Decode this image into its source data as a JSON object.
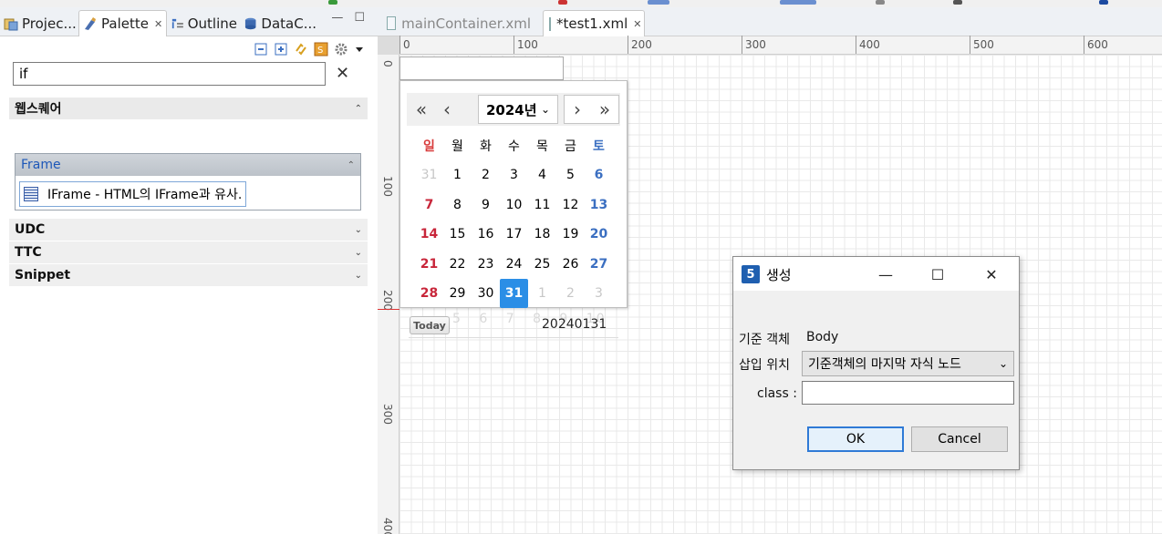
{
  "view_tabs": [
    {
      "label": "Projec...",
      "icon": "project-icon"
    },
    {
      "label": "Palette",
      "icon": "palette-icon",
      "active": true
    },
    {
      "label": "Outline",
      "icon": "outline-icon"
    },
    {
      "label": "DataC...",
      "icon": "data-collection-icon"
    }
  ],
  "palette": {
    "search_value": "if",
    "groups": [
      {
        "label": "웹스퀘어"
      },
      {
        "label": "UDC"
      },
      {
        "label": "TTC"
      },
      {
        "label": "Snippet"
      }
    ],
    "drawer": {
      "label": "Frame",
      "item": "IFrame - HTML의 IFrame과 유사."
    }
  },
  "editor_tabs": [
    {
      "label": "mainContainer.xml"
    },
    {
      "label": "*test1.xml",
      "active": true
    }
  ],
  "ruler": {
    "h_labels": [
      "0",
      "100",
      "200",
      "300",
      "400",
      "500",
      "600"
    ],
    "v_labels": [
      "0",
      "100",
      "200",
      "300",
      "400"
    ]
  },
  "calendar": {
    "year_label": "2024년",
    "weekdays": [
      "일",
      "월",
      "화",
      "수",
      "목",
      "금",
      "토"
    ],
    "weeks": [
      [
        "31",
        "1",
        "2",
        "3",
        "4",
        "5",
        "6"
      ],
      [
        "7",
        "8",
        "9",
        "10",
        "11",
        "12",
        "13"
      ],
      [
        "14",
        "15",
        "16",
        "17",
        "18",
        "19",
        "20"
      ],
      [
        "21",
        "22",
        "23",
        "24",
        "25",
        "26",
        "27"
      ],
      [
        "28",
        "29",
        "30",
        "31",
        "1",
        "2",
        "3"
      ]
    ],
    "selected": "31",
    "today_label": "Today",
    "ghost_row": "5 6 7 8 9 10",
    "value": "20240131",
    "colors": {
      "sunday": "#c8263a",
      "saturday": "#3b6fc1",
      "selected": "#2b8ee6"
    }
  },
  "dialog": {
    "title": "생성",
    "logo": "5",
    "base_label": "기준 객체",
    "base_value": "Body",
    "insert_label": "삽입 위치",
    "insert_value": "기준객체의 마지막 자식 노드",
    "class_label": "class :",
    "ok_label": "OK",
    "cancel_label": "Cancel"
  }
}
